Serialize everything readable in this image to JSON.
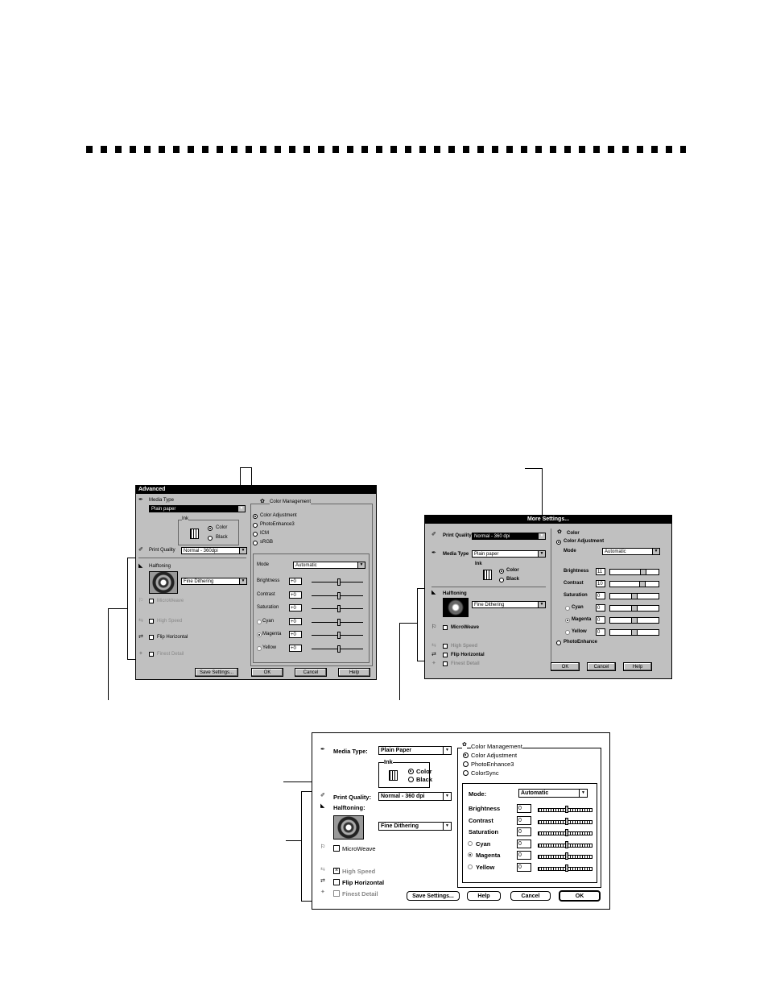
{
  "win_advanced": {
    "title": "Advanced",
    "media_type_label": "Media Type",
    "media_type_value": "Plain paper",
    "ink_label": "Ink",
    "ink_color": "Color",
    "ink_black": "Black",
    "print_quality_label": "Print Quality",
    "print_quality_value": "Normal - 360dpi",
    "halftoning_label": "Halftoning",
    "halftoning_value": "Fine Dithering",
    "microweave": "MicroWeave",
    "high_speed": "High Speed",
    "flip_horizontal": "Flip Horizontal",
    "finest_detail": "Finest Detail",
    "color_management": "Color Management",
    "color_adjustment": "Color Adjustment",
    "photoenhance": "PhotoEnhance3",
    "icm": "ICM",
    "srgb": "sRGB",
    "mode_label": "Mode",
    "mode_value": "Automatic",
    "sliders": [
      {
        "label": "Brightness",
        "value": "+0"
      },
      {
        "label": "Contrast",
        "value": "+0"
      },
      {
        "label": "Saturation",
        "value": "+0"
      },
      {
        "label": "Cyan",
        "value": "+0"
      },
      {
        "label": "Magenta",
        "value": "+0"
      },
      {
        "label": "Yellow",
        "value": "+0"
      }
    ],
    "save_settings": "Save Settings...",
    "ok": "OK",
    "cancel": "Cancel",
    "help": "Help"
  },
  "win_more": {
    "title": "More Settings...",
    "print_quality_label": "Print Quality",
    "print_quality_value": "Normal - 360 dpi",
    "media_type_label": "Media Type",
    "media_type_value": "Plain paper",
    "ink_label": "Ink",
    "ink_color": "Color",
    "ink_black": "Black",
    "halftoning_label": "Halftoning",
    "halftoning_value": "Fine Dithering",
    "microweave": "MicroWeave",
    "high_speed": "High Speed",
    "flip_horizontal": "Flip Horizontal",
    "finest_detail": "Finest Detail",
    "color": "Color",
    "color_adjustment": "Color Adjustment",
    "mode_label": "Mode",
    "mode_value": "Automatic",
    "sliders": [
      {
        "label": "Brightness",
        "value": "11"
      },
      {
        "label": "Contrast",
        "value": "10"
      },
      {
        "label": "Saturation",
        "value": "0"
      },
      {
        "label": "Cyan",
        "value": "0"
      },
      {
        "label": "Magenta",
        "value": "0"
      },
      {
        "label": "Yellow",
        "value": "0"
      }
    ],
    "photoenhance": "PhotoEnhance",
    "ok": "OK",
    "cancel": "Cancel",
    "help": "Help"
  },
  "win_mac": {
    "media_type_label": "Media Type:",
    "media_type_value": "Plain Paper",
    "ink_label": "Ink",
    "ink_color": "Color",
    "ink_black": "Black",
    "print_quality_label": "Print Quality:",
    "print_quality_value": "Normal - 360 dpi",
    "halftoning_label": "Halftoning:",
    "halftoning_value": "Fine Dithering",
    "microweave": "MicroWeave",
    "high_speed": "High Speed",
    "flip_horizontal": "Flip Horizontal",
    "finest_detail": "Finest Detail",
    "color_management": "Color Management",
    "color_adjustment": "Color Adjustment",
    "photoenhance": "PhotoEnhance3",
    "colorsync": "ColorSync",
    "mode_label": "Mode:",
    "mode_value": "Automatic",
    "sliders": [
      {
        "label": "Brightness",
        "value": "0"
      },
      {
        "label": "Contrast",
        "value": "0"
      },
      {
        "label": "Saturation",
        "value": "0"
      },
      {
        "label": "Cyan",
        "value": "0"
      },
      {
        "label": "Magenta",
        "value": "0"
      },
      {
        "label": "Yellow",
        "value": "0"
      }
    ],
    "save_settings": "Save Settings...",
    "help": "Help",
    "cancel": "Cancel",
    "ok": "OK"
  }
}
